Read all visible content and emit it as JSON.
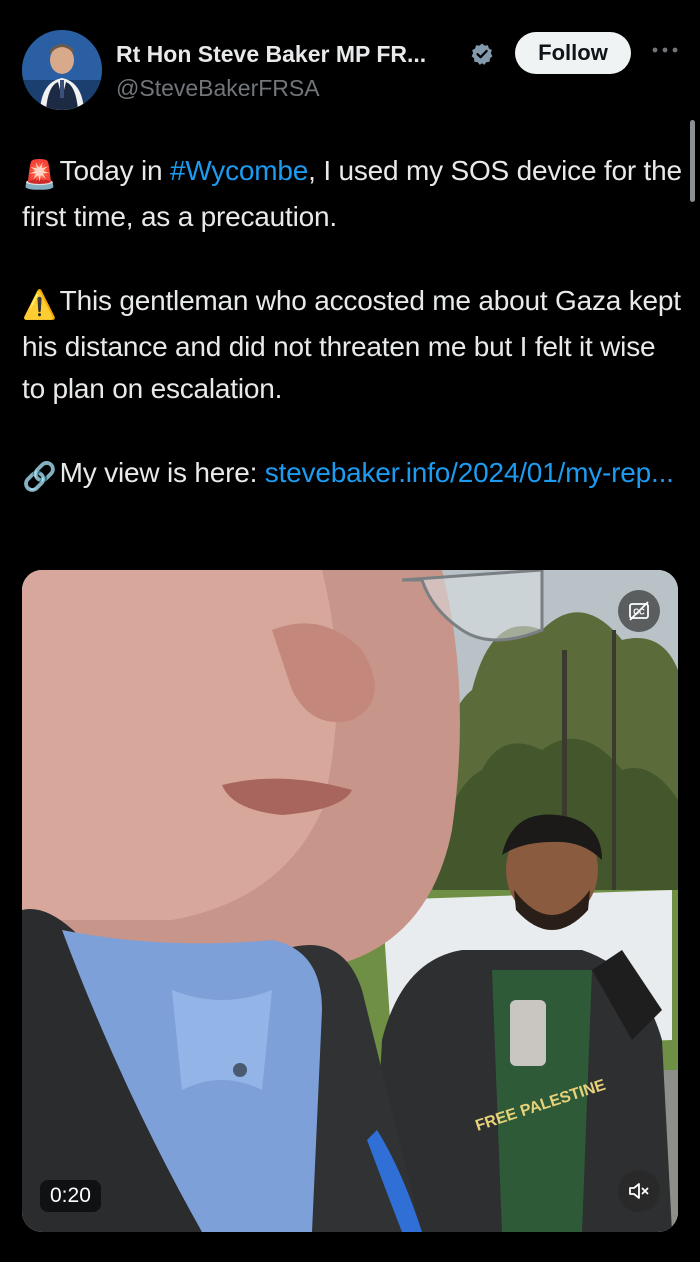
{
  "author": {
    "name": "Rt Hon Steve Baker MP FR...",
    "handle": "@SteveBakerFRSA",
    "verified": true,
    "avatar_icon": "profile-photo"
  },
  "actions": {
    "follow_label": "Follow",
    "more_icon": "more-dots-icon"
  },
  "tweet": {
    "p1_emoji": "🚨",
    "p1_before": "Today in ",
    "p1_hashtag": "#Wycombe",
    "p1_after": ", I used my SOS device for the first time, as a precaution.",
    "p2_emoji": "⚠️",
    "p2_text": "This gentleman who accosted me about Gaza kept his distance and did not threaten me but I felt it wise to plan on escalation.",
    "p3_emoji": "🔗",
    "p3_text": "My view is here: ",
    "p3_link": "stevebaker.info/2024/01/my-rep..."
  },
  "media": {
    "duration": "0:20",
    "cc_icon": "closed-captions-off-icon",
    "mute_icon": "muted-speaker-icon",
    "shirt_text": "FREE PALESTINE"
  },
  "colors": {
    "background": "#000000",
    "link": "#1d9bf0",
    "text": "#e7e9ea",
    "muted": "#71767b"
  }
}
